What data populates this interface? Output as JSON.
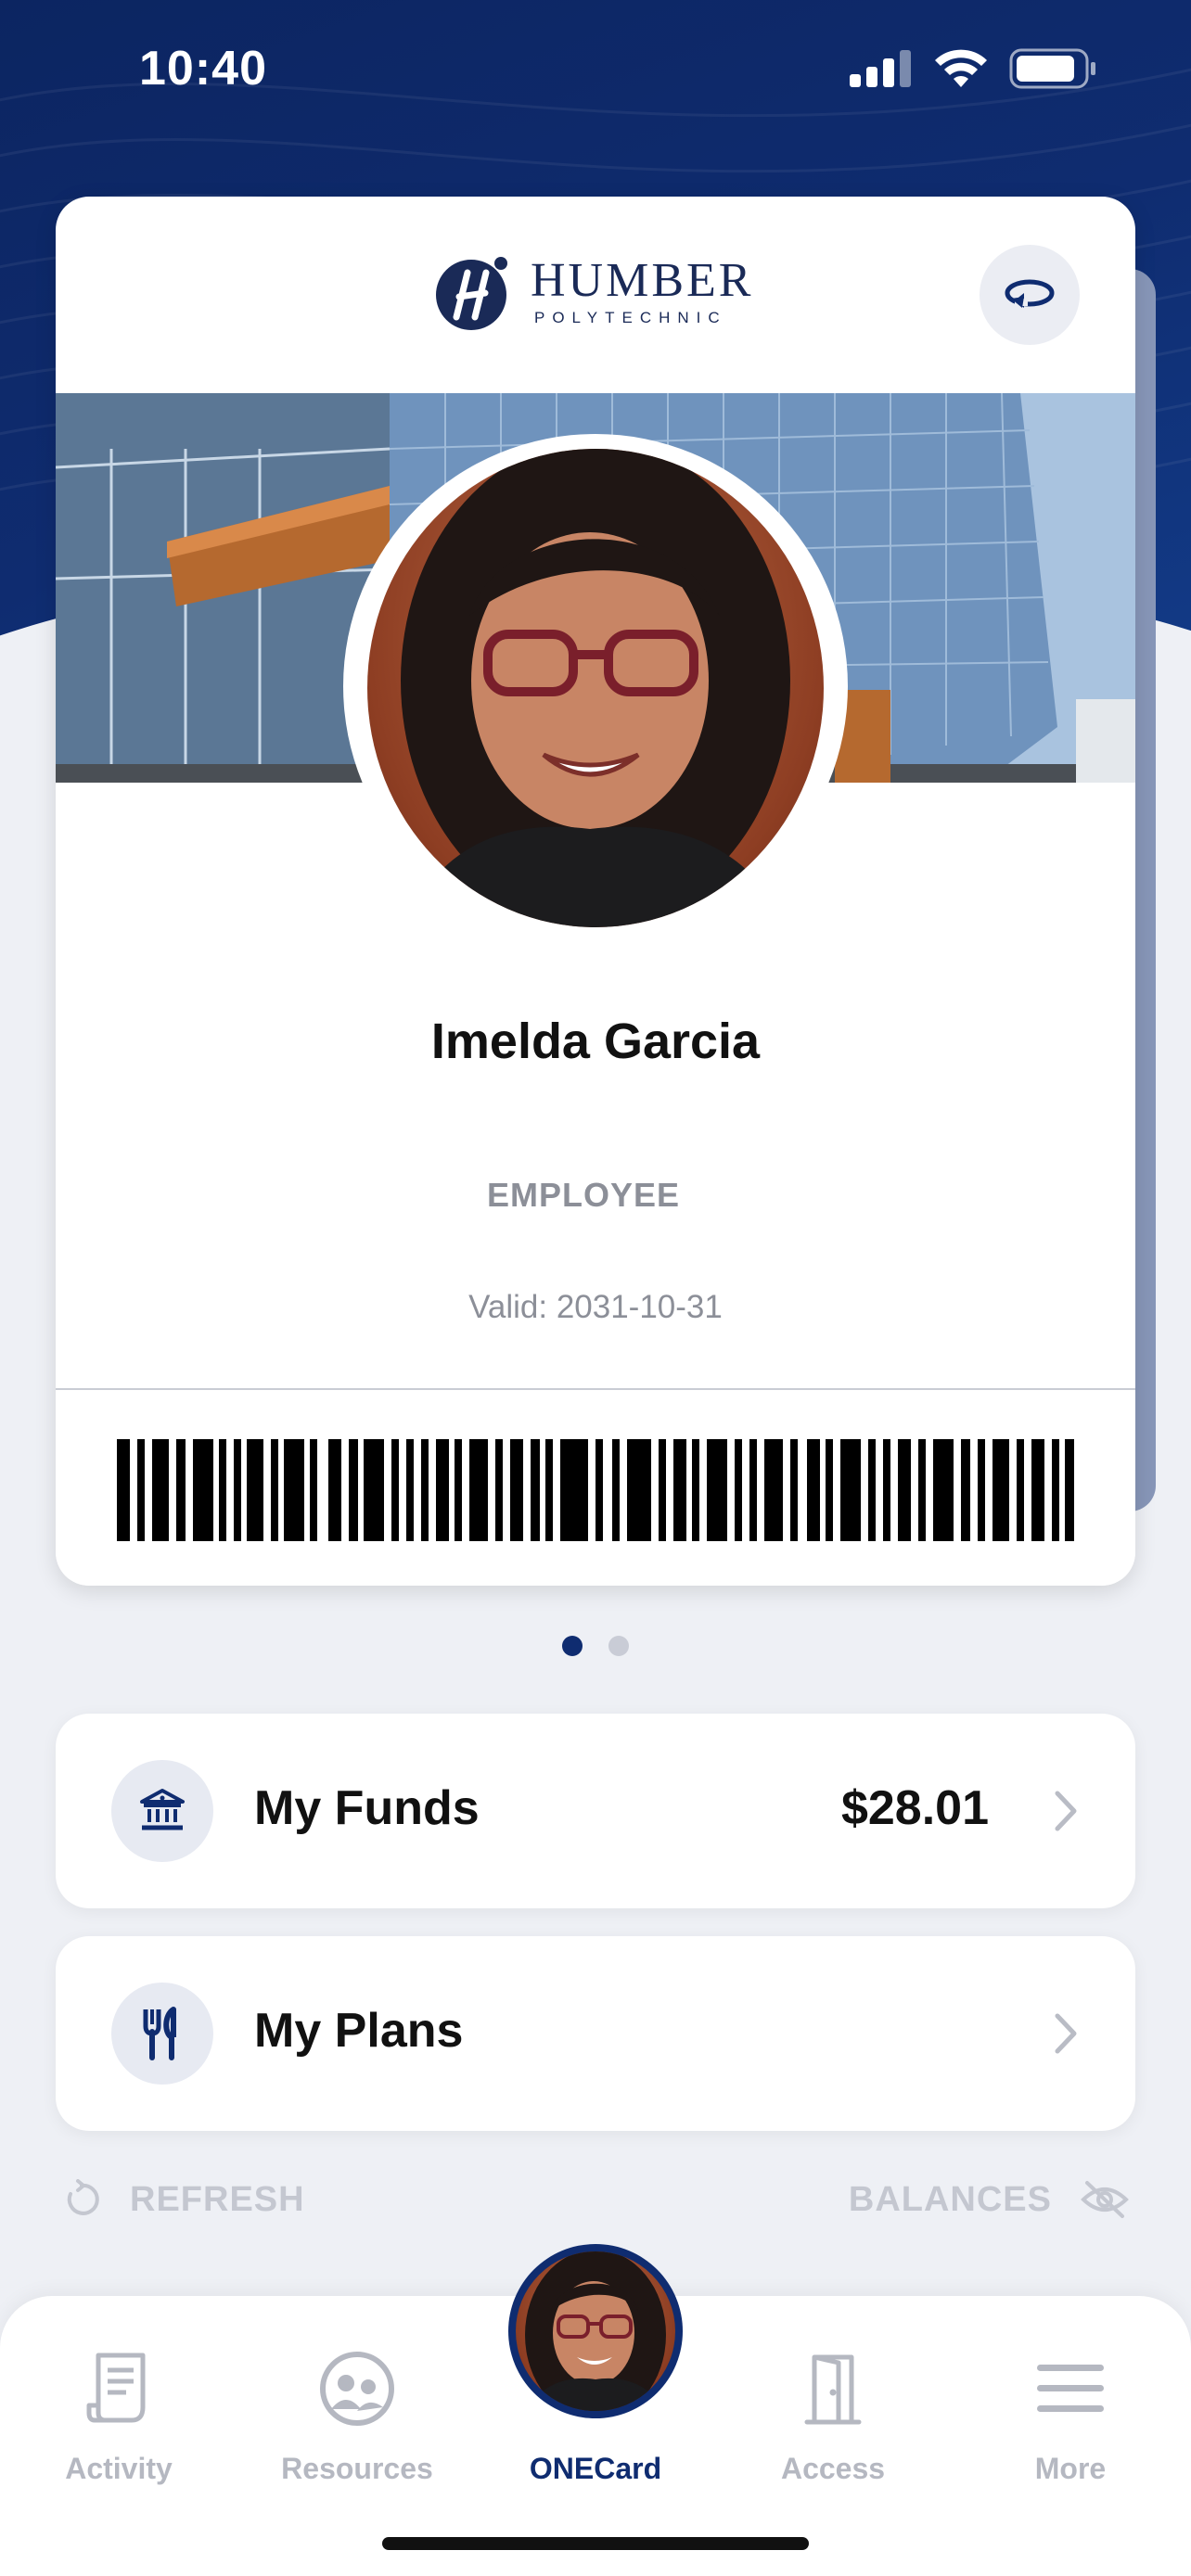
{
  "status_bar": {
    "time": "10:40"
  },
  "card": {
    "brand_name": "HUMBER",
    "brand_subtitle": "POLYTECHNIC",
    "flip_icon": "flip-card-icon",
    "name": "Imelda Garcia",
    "role": "EMPLOYEE",
    "valid": "Valid: 2031-10-31"
  },
  "pager": {
    "count": 2,
    "active_index": 0
  },
  "funds": {
    "label": "My Funds",
    "amount": "$28.01",
    "icon": "bank-icon"
  },
  "plans": {
    "label": "My Plans",
    "icon": "utensils-icon"
  },
  "actions": {
    "refresh_label": "REFRESH",
    "balances_label": "BALANCES"
  },
  "tabs": [
    {
      "label": "Activity",
      "icon": "receipt-icon"
    },
    {
      "label": "Resources",
      "icon": "resources-icon"
    },
    {
      "label": "ONECard",
      "icon": "avatar"
    },
    {
      "label": "Access",
      "icon": "door-icon"
    },
    {
      "label": "More",
      "icon": "menu-icon"
    }
  ],
  "colors": {
    "brand_navy": "#0f2c70",
    "background": "#eef0f5",
    "muted_text": "#8c8f98"
  }
}
